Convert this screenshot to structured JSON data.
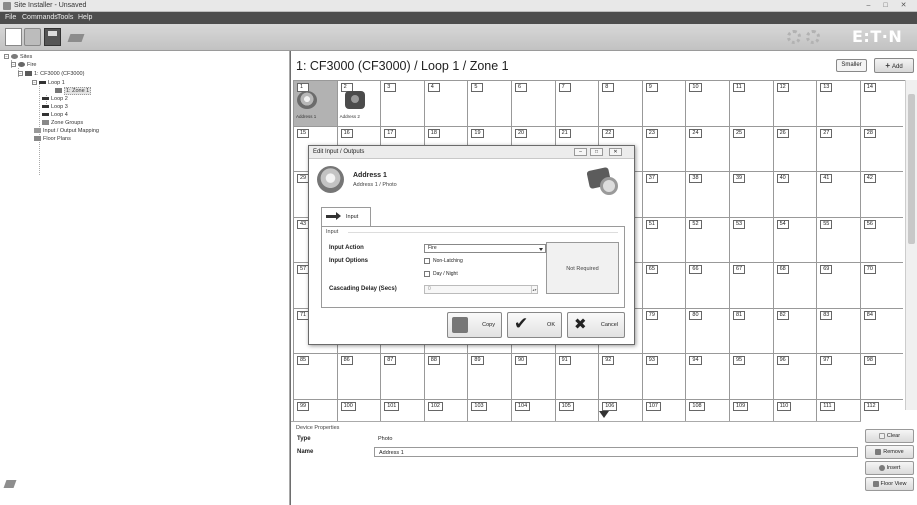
{
  "window": {
    "title": "Site Installer - Unsaved",
    "controls": [
      "–",
      "□",
      "✕"
    ]
  },
  "menu": [
    "File",
    "Commands",
    "Tools",
    "Help"
  ],
  "toolbar": {
    "icons": [
      "new-file-icon",
      "open-folder-icon",
      "save-icon",
      "program-icon",
      "settings-gear-icon",
      "settings-gear-icon"
    ],
    "logo": "E:T·N"
  },
  "tree": {
    "items": [
      {
        "label": "Sites"
      },
      {
        "label": "Fire"
      },
      {
        "label": "1: CF3000 (CF3000)"
      },
      {
        "label": "Loop 1"
      },
      {
        "label": "1: Zone 1",
        "selected": true
      },
      {
        "label": "Loop 2"
      },
      {
        "label": "Loop 3"
      },
      {
        "label": "Loop 4"
      },
      {
        "label": "Zone Groups"
      },
      {
        "label": "Input / Output Mapping"
      },
      {
        "label": "Floor Plans"
      }
    ]
  },
  "main": {
    "title": "1: CF3000 (CF3000) / Loop 1 / Zone 1",
    "smaller_label": "Smaller",
    "add_label": "Add",
    "address_range": [
      1,
      112
    ],
    "columns": 14,
    "devices": [
      {
        "address": 1,
        "label": "Address 1",
        "kind": "photo"
      },
      {
        "address": 2,
        "label": "Address 2",
        "kind": "multi"
      }
    ]
  },
  "dialog": {
    "title": "Edit Input / Outputs",
    "device_name": "Address 1",
    "device_sub": "Address 1 / Photo",
    "tab_label": "Input",
    "group_label": "Input",
    "input_action_label": "Input Action",
    "input_action_value": "Fire",
    "input_options_label": "Input Options",
    "option_non_latching": "Non-Latching",
    "option_day_night": "Day / Night",
    "cascading_label": "Cascading Delay (Secs)",
    "cascading_value": "0",
    "not_required": "Not Required",
    "copy_label": "Copy",
    "ok_label": "OK",
    "cancel_label": "Cancel"
  },
  "properties": {
    "header": "Device Properties",
    "type_label": "Type",
    "type_value": "Photo",
    "name_label": "Name",
    "name_value": "Address 1"
  },
  "side_buttons": {
    "clear": "Clear",
    "remove": "Remove",
    "insert": "Insert",
    "floor_view": "Floor View"
  }
}
